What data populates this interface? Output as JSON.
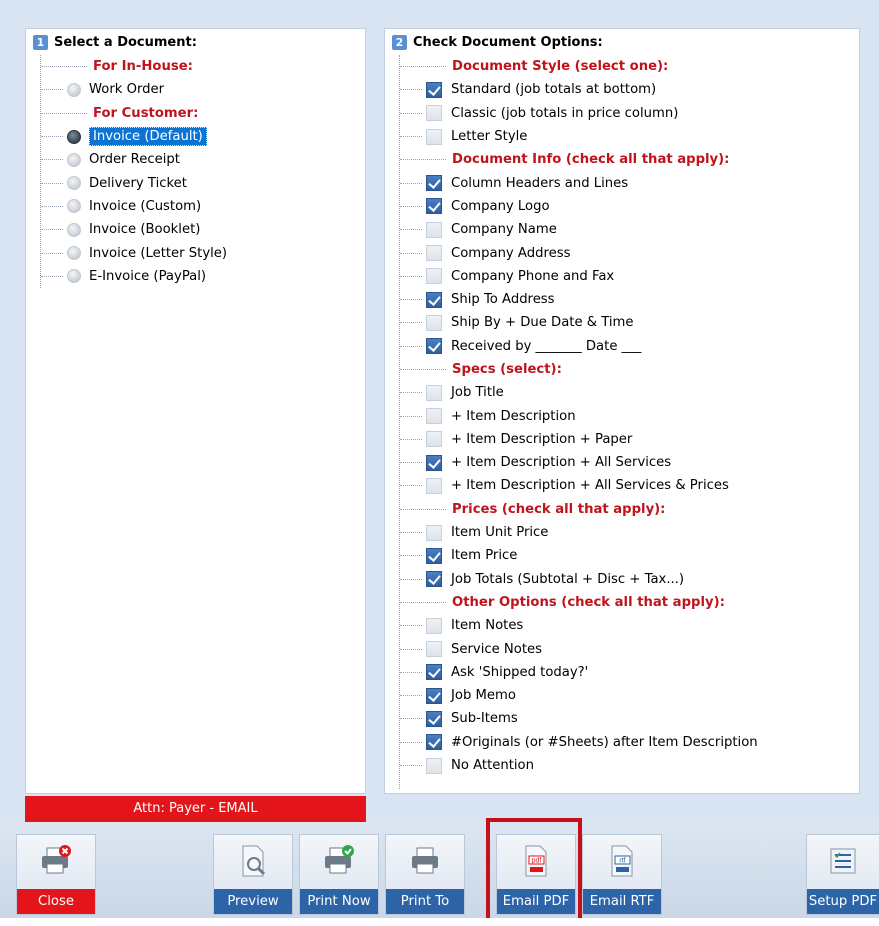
{
  "left": {
    "number": "1",
    "title": "Select a Document:",
    "groups": [
      {
        "category": "For In-House:",
        "items": [
          {
            "label": "Work Order",
            "selected": false
          }
        ]
      },
      {
        "category": "For Customer:",
        "items": [
          {
            "label": "Invoice (Default)",
            "selected": true
          },
          {
            "label": "Order Receipt",
            "selected": false
          },
          {
            "label": "Delivery Ticket",
            "selected": false
          },
          {
            "label": "Invoice (Custom)",
            "selected": false
          },
          {
            "label": "Invoice (Booklet)",
            "selected": false
          },
          {
            "label": "Invoice (Letter Style)",
            "selected": false
          },
          {
            "label": "E-Invoice (PayPal)",
            "selected": false
          }
        ]
      }
    ],
    "attn": "Attn: Payer - EMAIL"
  },
  "right": {
    "number": "2",
    "title": "Check Document Options:",
    "groups": [
      {
        "category": "Document Style (select one):",
        "items": [
          {
            "label": "Standard (job totals at bottom)",
            "checked": true
          },
          {
            "label": "Classic (job totals in price column)",
            "checked": false
          },
          {
            "label": "Letter Style",
            "checked": false
          }
        ]
      },
      {
        "category": "Document Info (check all that apply):",
        "items": [
          {
            "label": "Column Headers and Lines",
            "checked": true
          },
          {
            "label": "Company Logo",
            "checked": true
          },
          {
            "label": "Company Name",
            "checked": false
          },
          {
            "label": "Company Address",
            "checked": false
          },
          {
            "label": "Company Phone and Fax",
            "checked": false
          },
          {
            "label": "Ship To Address",
            "checked": true
          },
          {
            "label": "Ship By + Due Date & Time",
            "checked": false
          },
          {
            "label": "Received by _______ Date ___",
            "checked": true
          }
        ]
      },
      {
        "category": "Specs (select):",
        "items": [
          {
            "label": "Job Title",
            "checked": false
          },
          {
            "label": "+ Item Description",
            "checked": false
          },
          {
            "label": "+ Item Description + Paper",
            "checked": false
          },
          {
            "label": "+ Item Description + All Services",
            "checked": true
          },
          {
            "label": "+ Item Description + All Services & Prices",
            "checked": false
          }
        ]
      },
      {
        "category": "Prices (check all that apply):",
        "items": [
          {
            "label": "Item Unit Price",
            "checked": false
          },
          {
            "label": "Item Price",
            "checked": true
          },
          {
            "label": "Job Totals (Subtotal + Disc + Tax...)",
            "checked": true
          }
        ]
      },
      {
        "category": "Other Options (check all that apply):",
        "items": [
          {
            "label": "Item Notes",
            "checked": false
          },
          {
            "label": "Service Notes",
            "checked": false
          },
          {
            "label": "Ask 'Shipped today?'",
            "checked": true
          },
          {
            "label": "Job Memo",
            "checked": true
          },
          {
            "label": "Sub-Items",
            "checked": true
          },
          {
            "label": "#Originals (or #Sheets) after Item Description",
            "checked": true
          },
          {
            "label": "No Attention",
            "checked": false
          }
        ]
      }
    ]
  },
  "toolbar": {
    "close": "Close",
    "preview": "Preview",
    "print_now": "Print Now",
    "print_to": "Print To",
    "email_pdf": "Email PDF",
    "email_rtf": "Email RTF",
    "setup_pdf": "Setup PDF",
    "icons": {
      "close": "printer-with-red-x-icon",
      "preview": "document-magnifier-icon",
      "print_now": "printer-with-green-check-icon",
      "print_to": "printer-icon",
      "email_pdf": "pdf-document-icon",
      "email_rtf": "rtf-document-icon",
      "setup_pdf": "settings-list-icon"
    }
  },
  "colors": {
    "category": "#c0141c",
    "selection": "#0a73d4",
    "button_caption": "#2d64a8",
    "close_caption": "#e3151b",
    "highlight": "#c4111a"
  }
}
